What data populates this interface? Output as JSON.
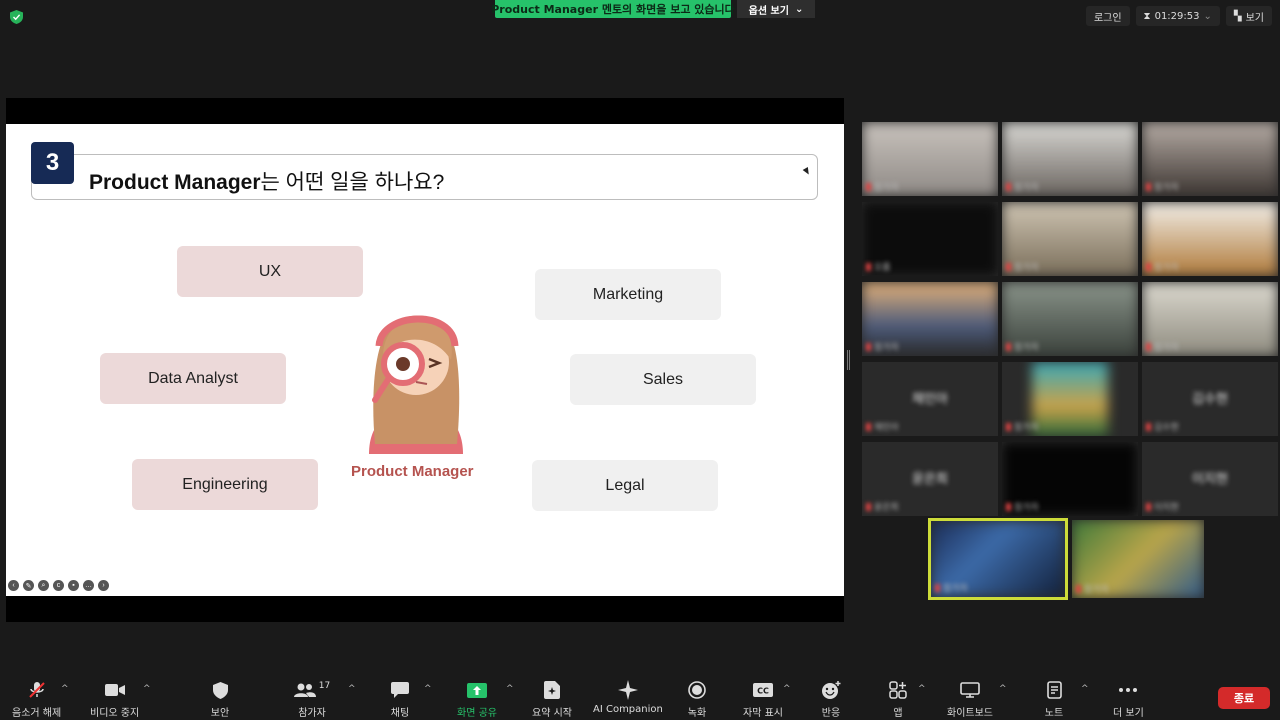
{
  "topbar": {
    "share_banner": "Product  Manager 멘토의 화면을 보고 있습니다",
    "view_options": "옵션 보기",
    "login": "로그인",
    "timer": "01:29:53",
    "view": "보기"
  },
  "slide": {
    "number": "3",
    "title_bold": "Product Manager",
    "title_rest": "는 어떤 일을 하나요?",
    "center_label": "Product Manager",
    "roles_left": [
      "UX",
      "Data Analyst",
      "Engineering"
    ],
    "roles_right": [
      "Marketing",
      "Sales",
      "Legal"
    ]
  },
  "gallery": {
    "tiles": [
      {
        "label": "",
        "name": "참가자"
      },
      {
        "label": "",
        "name": "참가자"
      },
      {
        "label": "",
        "name": "참가자"
      },
      {
        "label": "",
        "name": "오름"
      },
      {
        "label": "",
        "name": "참가자"
      },
      {
        "label": "",
        "name": "참가자"
      },
      {
        "label": "",
        "name": "참가자"
      },
      {
        "label": "",
        "name": "참가자"
      },
      {
        "label": "",
        "name": "참가자"
      },
      {
        "label": "채민아",
        "name": "채민아"
      },
      {
        "label": "",
        "name": "참가자"
      },
      {
        "label": "김수현",
        "name": "김수현"
      },
      {
        "label": "윤은희",
        "name": "윤은희"
      },
      {
        "label": "",
        "name": "참가자"
      },
      {
        "label": "이지현",
        "name": "이지현"
      },
      {
        "label": "",
        "name": "참가자"
      },
      {
        "label": "",
        "name": "참가자"
      }
    ]
  },
  "toolbar": {
    "mute": "음소거 해제",
    "video": "비디오 중지",
    "security": "보안",
    "participants": "참가자",
    "participants_count": "17",
    "chat": "채팅",
    "share": "화면 공유",
    "summary": "요약 시작",
    "ai": "AI Companion",
    "record": "녹화",
    "captions": "자막 표시",
    "reactions": "반응",
    "apps": "앱",
    "whiteboard": "화이트보드",
    "notes": "노트",
    "more": "더 보기",
    "end": "종료"
  },
  "colors": {
    "share_green": "#26c26a",
    "end_red": "#d42a2a",
    "badge_navy": "#162a55",
    "pm_label": "#b5534f",
    "pill_pink": "#ecd9d9",
    "pill_grey": "#f0f0f0",
    "active_speaker": "#cddc39"
  }
}
